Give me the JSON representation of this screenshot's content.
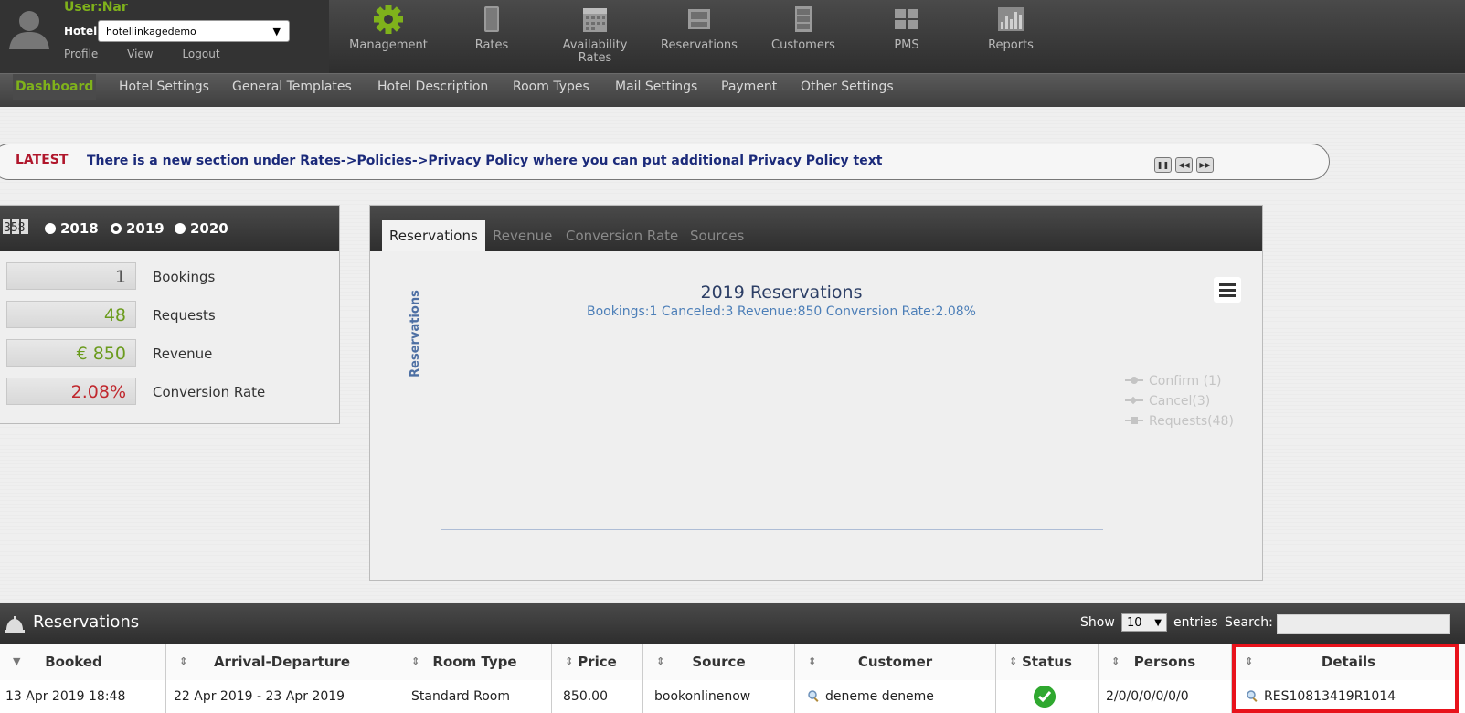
{
  "user": {
    "name": "User:Nar",
    "hotel_label": "Hotel",
    "hotel_value": "hotellinkagedemo",
    "links": [
      "Profile",
      "View",
      "Logout"
    ]
  },
  "topnav": [
    {
      "label": "Management",
      "icon": "gear-icon"
    },
    {
      "label": "Rates",
      "icon": "book-icon"
    },
    {
      "label": "Availability\nRates",
      "icon": "calendar-icon"
    },
    {
      "label": "Reservations",
      "icon": "tray-icon"
    },
    {
      "label": "Customers",
      "icon": "cabinet-icon"
    },
    {
      "label": "PMS",
      "icon": "grid-icon"
    },
    {
      "label": "Reports",
      "icon": "bar-chart-icon"
    }
  ],
  "subnav": [
    "Dashboard",
    "Hotel Settings",
    "General Templates",
    "Hotel Description",
    "Room Types",
    "Mail Settings",
    "Payment",
    "Other Settings"
  ],
  "ticker": {
    "label": "LATEST",
    "text": "There is a new section under Rates->Policies->Privacy Policy where you can put additional Privacy Policy text"
  },
  "stats": {
    "years": [
      "2018",
      "2019",
      "2020"
    ],
    "selected_year": "2019",
    "items": [
      {
        "value": "1",
        "label": "Bookings",
        "color": "#555555"
      },
      {
        "value": "48",
        "label": "Requests",
        "color": "#6a9b1c"
      },
      {
        "value": "€ 850",
        "label": "Revenue",
        "color": "#6a9b1c"
      },
      {
        "value": "2.08%",
        "label": "Conversion Rate",
        "color": "#c0272d"
      }
    ]
  },
  "chart": {
    "tabs": [
      "Reservations",
      "Revenue",
      "Conversion Rate",
      "Sources"
    ],
    "active_tab": "Reservations"
  },
  "chart_data": {
    "type": "line",
    "title": "2019 Reservations",
    "subtitle": "Bookings:1 Canceled:3 Revenue:850 Conversion Rate:2.08%",
    "ylabel": "Reservations",
    "legend": [
      "Confirm (1)",
      "Cancel(3)",
      "Requests(48)"
    ],
    "series": [
      {
        "name": "Confirm (1)",
        "values": []
      },
      {
        "name": "Cancel(3)",
        "values": []
      },
      {
        "name": "Requests(48)",
        "values": []
      }
    ]
  },
  "reservations": {
    "title": "Reservations",
    "show_label": "Show",
    "show_value": "10",
    "entries_label": "entries",
    "search_label": "Search:",
    "columns": [
      "Booked",
      "Arrival-Departure",
      "Room Type",
      "Price",
      "Source",
      "Customer",
      "Status",
      "Persons",
      "Details"
    ],
    "rows": [
      {
        "booked": "13 Apr 2019 18:48",
        "arrival_departure": "22 Apr 2019 - 23 Apr 2019",
        "room_type": "Standard Room",
        "price": "850.00",
        "source": "bookonlinenow",
        "customer": "deneme deneme",
        "status": "confirmed",
        "persons": "2/0/0/0/0/0/0",
        "details": "RES10813419R1014"
      }
    ]
  }
}
